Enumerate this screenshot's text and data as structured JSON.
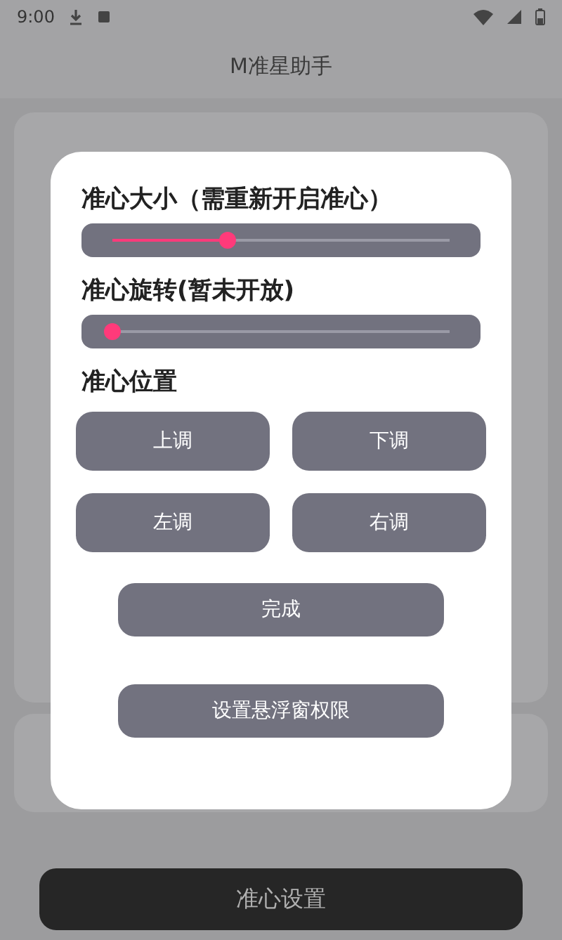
{
  "status_bar": {
    "time": "9:00"
  },
  "app_bar": {
    "title": "M准星助手"
  },
  "dialog": {
    "sliders": [
      {
        "label": "准心大小（需重新开启准心）",
        "level": 0.34
      },
      {
        "label": "准心旋转(暂未开放)",
        "level": 0.0
      }
    ],
    "position_label": "准心位置",
    "position_buttons": [
      "上调",
      "下调",
      "左调",
      "右调"
    ],
    "done_button": "完成",
    "permission_button": "设置悬浮窗权限"
  },
  "bottom_button": "准心设置"
}
